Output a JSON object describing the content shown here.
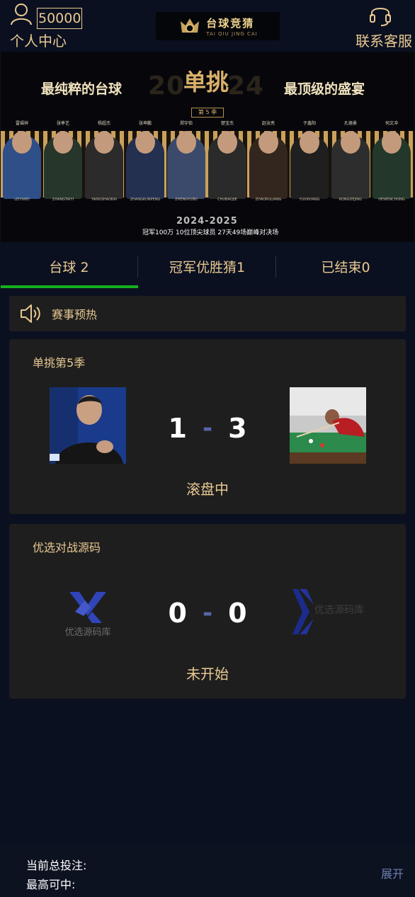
{
  "header": {
    "balance": "50000",
    "user_label": "个人中心",
    "logo_title": "台球竞猜",
    "logo_sub": "TAI QIU JING CAI",
    "service_label": "联系客服"
  },
  "banner": {
    "slogan_left": "最纯粹的台球",
    "slogan_right": "最顶级的盛宴",
    "year_left": "20",
    "year_right": "24",
    "brand": "单挑",
    "season": "第 5 季",
    "players": [
      {
        "name": "雷福祥",
        "en": "LEIYIWEI"
      },
      {
        "name": "张季艺",
        "en": "ZHANGTAIYI"
      },
      {
        "name": "杨超杰",
        "en": "YANGSHAOKAI"
      },
      {
        "name": "张坤鹏",
        "en": "ZHANGKUNPENG"
      },
      {
        "name": "郑宇伯",
        "en": "ZHENGYUBO"
      },
      {
        "name": "楚宝杰",
        "en": "CHUBAOJIE"
      },
      {
        "name": "赵汝亮",
        "en": "ZHAORULIANG"
      },
      {
        "name": "于鑫阳",
        "en": "YUXINYANG"
      },
      {
        "name": "孔德景",
        "en": "KONGDEJING"
      },
      {
        "name": "何文冲",
        "en": "HEWENCHONG"
      }
    ],
    "dates": "2024-2025",
    "info": "冠军100万  10位顶尖球员  27天49场巅峰对决场"
  },
  "tabs": [
    {
      "label": "台球 2"
    },
    {
      "label": "冠军优胜猜1"
    },
    {
      "label": "已结束0"
    }
  ],
  "notice": {
    "text": "赛事预热"
  },
  "matches": [
    {
      "league": "单挑第5季",
      "home_score": "1",
      "away_score": "3",
      "status": "滚盘中"
    },
    {
      "league": "优选对战源码",
      "home_score": "0",
      "away_score": "0",
      "status": "未开始",
      "logo_text": "优选源码库",
      "logo_text_right": "优选源码库"
    }
  ],
  "footer": {
    "total_bet_label": "当前总投注:",
    "max_win_label": "最高可中:",
    "expand_label": "展开"
  },
  "colors": {
    "background": "#0b1020",
    "card": "#1e1e1e",
    "gold": "#e7c992",
    "active_tab": "#14b01f",
    "dash": "#5865a8"
  }
}
